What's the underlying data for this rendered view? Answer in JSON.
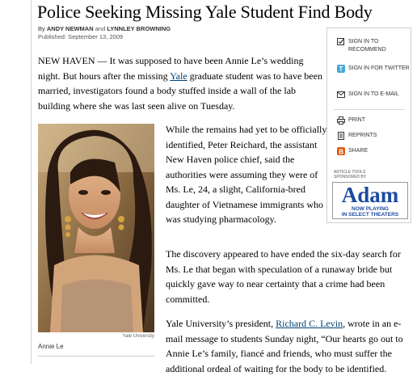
{
  "article": {
    "headline": "Police Seeking Missing Yale Student Find Body",
    "byline": {
      "by": "By",
      "author1": "ANDY NEWMAN",
      "and": "and",
      "author2": "LYNNLEY BROWNING"
    },
    "published": "Published: September 13, 2009",
    "p1": {
      "before": "NEW HAVEN — It was supposed to have been Annie Le’s wedding night. But hours after the missing ",
      "link": "Yale",
      "after": " graduate student was to have been married, investigators found a body stuffed inside a wall of the lab building where she was last seen alive on Tuesday."
    },
    "p2": "While the remains had yet to be officially identified, Peter Reichard, the assistant New Haven police chief, said the authorities were assuming they were of Ms. Le, 24, a slight, California-bred daughter of Vietnamese immigrants who was studying pharmacology.",
    "p3": "The discovery appeared to have ended the six-day search for Ms. Le that began with speculation of a runaway bride but quickly gave way to near certainty that a crime had been committed.",
    "p4": {
      "before": "Yale University’s president, ",
      "link": "Richard C. Levin",
      "after": ", wrote in an e-mail message to students Sunday night, “Our hearts go out to Annie Le’s family, fiancé and friends, who must suffer the additional ordeal of waiting for the body to be identified."
    },
    "photo": {
      "credit": "Yale University",
      "caption": "Annie Le"
    }
  },
  "tools": {
    "recommend": {
      "label": "SIGN IN TO RECOMMEND",
      "icon": "checkbox-icon"
    },
    "twitter": {
      "label": "SIGN IN FOR TWITTER",
      "icon": "twitter-icon"
    },
    "email": {
      "label": "SIGN IN TO E-MAIL",
      "icon": "envelope-icon"
    },
    "print": {
      "label": "PRINT",
      "icon": "printer-icon"
    },
    "reprints": {
      "label": "REPRINTS",
      "icon": "document-icon"
    },
    "share": {
      "label": "SHARE",
      "icon": "share-icon"
    },
    "sponsor_line1": "ARTICLE TOOLS",
    "sponsor_line2": "SPONSORED BY",
    "ad": {
      "brand": "Adam",
      "line1": "NOW PLAYING",
      "line2": "IN SELECT THEATERS",
      "color": "#1d4aa0"
    }
  },
  "colors": {
    "link": "#004276",
    "twitter": "#4aa6d8",
    "share": "#e05a10"
  }
}
